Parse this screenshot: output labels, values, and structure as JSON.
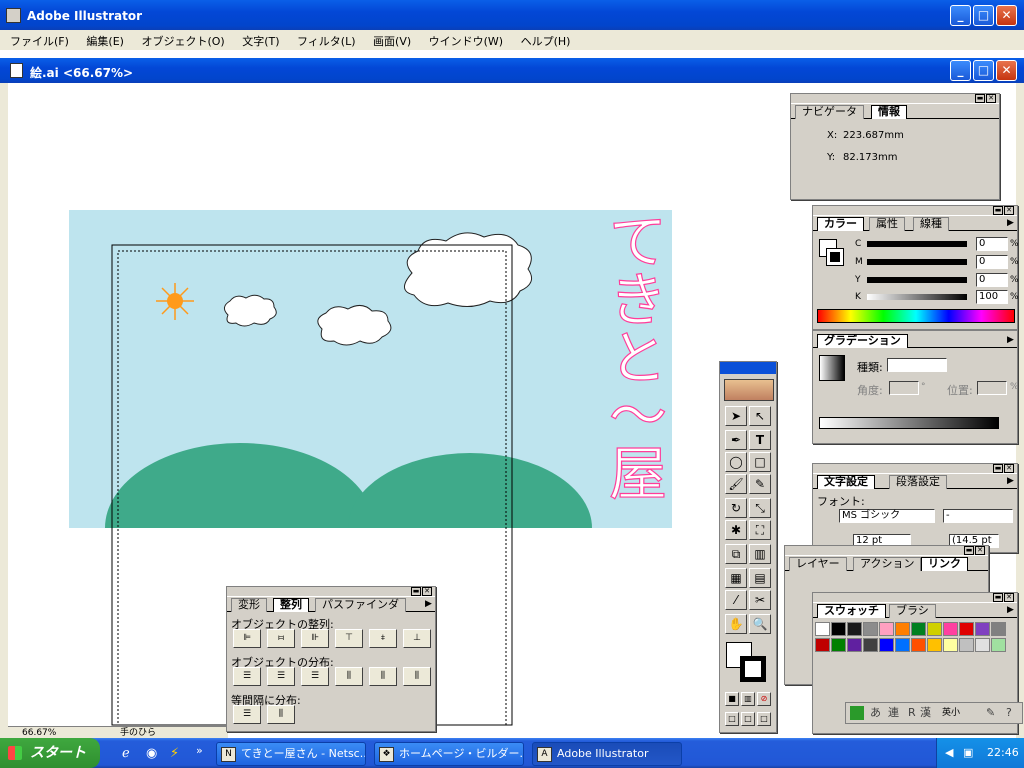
{
  "app": {
    "title": "Adobe Illustrator"
  },
  "menu": [
    "ファイル(F)",
    "編集(E)",
    "オブジェクト(O)",
    "文字(T)",
    "フィルタ(L)",
    "画面(V)",
    "ウインドウ(W)",
    "ヘルプ(H)"
  ],
  "document": {
    "title": "絵.ai <66.67%>"
  },
  "status": {
    "zoom": "66.67%",
    "tool": "手のひら"
  },
  "artwork": {
    "vertical_text": [
      "て",
      "き",
      "と",
      "～",
      "屋"
    ]
  },
  "info_palette": {
    "tabs": [
      "ナビゲータ",
      "情報"
    ],
    "x_label": "X:",
    "x_value": "223.687mm",
    "y_label": "Y:",
    "y_value": "82.173mm"
  },
  "color_palette": {
    "tabs": [
      "カラー",
      "属性",
      "線種"
    ],
    "rows": [
      {
        "label": "C",
        "value": "0",
        "unit": "%"
      },
      {
        "label": "M",
        "value": "0",
        "unit": "%"
      },
      {
        "label": "Y",
        "value": "0",
        "unit": "%"
      },
      {
        "label": "K",
        "value": "100",
        "unit": "%"
      }
    ]
  },
  "gradient_palette": {
    "tabs": [
      "グラデーション"
    ],
    "type_label": "種類:",
    "angle_label": "角度:",
    "angle_unit": "°",
    "position_label": "位置:",
    "position_unit": "%"
  },
  "character_palette": {
    "tabs": [
      "文字設定",
      "段落設定"
    ],
    "font_label": "フォント:",
    "font_value": "MS ゴシック",
    "style_value": "-",
    "size_value": "12 pt",
    "leading_value": "(14.5 pt"
  },
  "layers_palette": {
    "tabs": [
      "レイヤー",
      "アクション",
      "リンク"
    ]
  },
  "swatches_palette": {
    "tabs": [
      "スウォッチ",
      "ブラシ"
    ],
    "row1": [
      "#ffffff",
      "#000000",
      "#1a1a1a",
      "#8c8c8c",
      "#ffa0c0",
      "#ff7f00",
      "#008020",
      "#d0d000",
      "#ff40a0",
      "#e00000",
      "#8040c0",
      "#808080"
    ],
    "row2": [
      "#c00000",
      "#008000",
      "#6020a0",
      "#404040",
      "#0000ff",
      "#0070ff",
      "#ff5000",
      "#ffc000",
      "#ffffa0",
      "#c0c0c0",
      "#e0e0e0",
      "#a0e0a0"
    ]
  },
  "align_palette": {
    "tabs": [
      "変形",
      "整列",
      "パスファインダ"
    ],
    "section1": "オブジェクトの整列:",
    "section2": "オブジェクトの分布:",
    "section3": "等間隔に分布:"
  },
  "ime": {
    "chars": [
      "あ",
      "連",
      "R",
      "漢",
      "英小"
    ]
  },
  "taskbar": {
    "start": "スタート",
    "tasks": [
      {
        "label": "てきとー屋さん - Netsc..."
      },
      {
        "label": "ホームページ・ビルダー..."
      },
      {
        "label": "Adobe Illustrator"
      }
    ],
    "clock": "22:46"
  },
  "colors": {
    "sky": "#bee4ee",
    "hills": "#3faa8a",
    "sun": "#ff9a1a",
    "text_pink": "#ff3d9a"
  }
}
